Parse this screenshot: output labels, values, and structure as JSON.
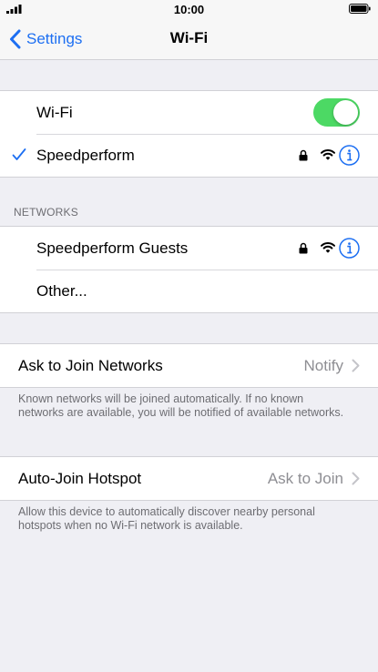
{
  "status_bar": {
    "time": "10:00"
  },
  "nav": {
    "back_label": "Settings",
    "title": "Wi-Fi"
  },
  "wifi_group": {
    "wifi_label": "Wi-Fi",
    "wifi_enabled": true,
    "connected_network": "Speedperform"
  },
  "networks": {
    "header": "NETWORKS",
    "items": [
      {
        "name": "Speedperform Guests"
      },
      {
        "name": "Other..."
      }
    ]
  },
  "ask_to_join": {
    "label": "Ask to Join Networks",
    "value": "Notify",
    "footer": "Known networks will be joined automatically. If no known networks are available, you will be notified of available networks."
  },
  "auto_join_hotspot": {
    "label": "Auto-Join Hotspot",
    "value": "Ask to Join",
    "footer": "Allow this device to automatically discover nearby personal hotspots when no Wi-Fi network is available."
  },
  "colors": {
    "accent": "#1d6ff2",
    "toggle_on": "#4cd964",
    "background": "#efeff4"
  },
  "icons": {
    "back": "chevron-left-icon",
    "check": "checkmark-icon",
    "lock": "lock-icon",
    "wifi": "wifi-icon",
    "info": "info-icon",
    "chevron": "chevron-right-icon"
  }
}
